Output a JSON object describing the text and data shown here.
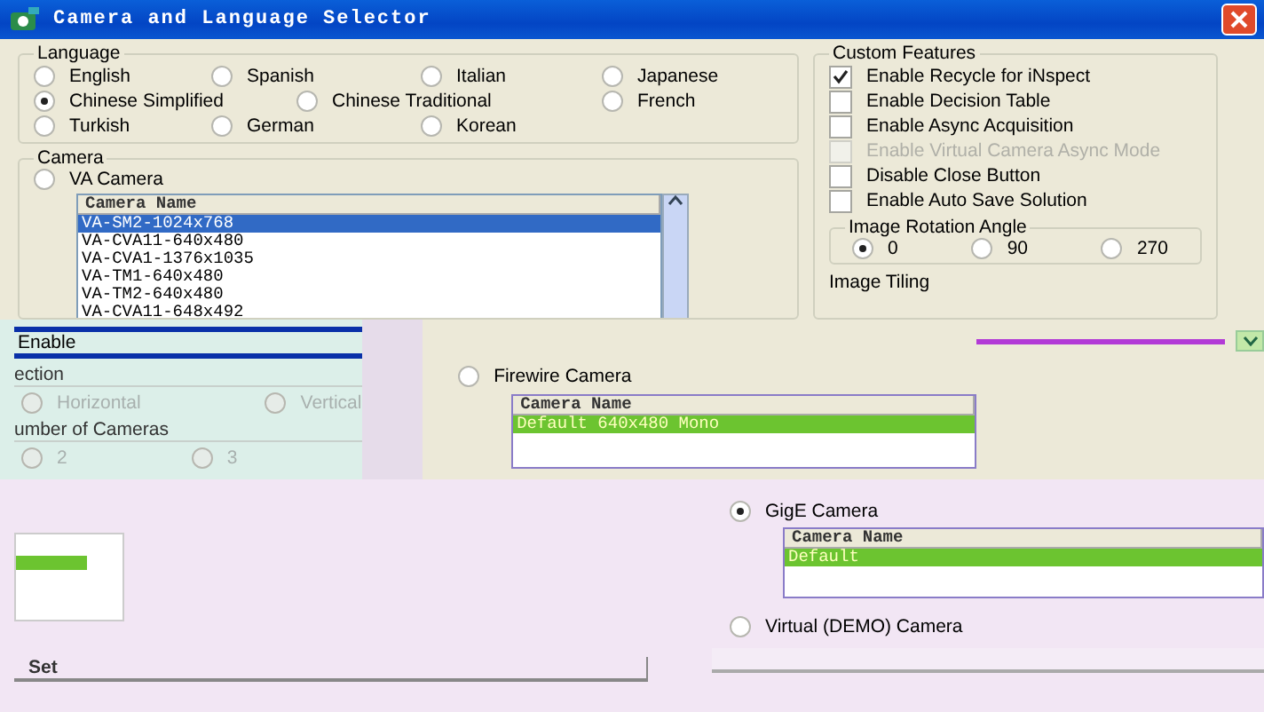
{
  "window": {
    "title": "Camera and Language Selector"
  },
  "language": {
    "title": "Language",
    "options": [
      {
        "label": "English",
        "selected": false
      },
      {
        "label": "Spanish",
        "selected": false
      },
      {
        "label": "Italian",
        "selected": false
      },
      {
        "label": "Japanese",
        "selected": false
      },
      {
        "label": "Chinese Simplified",
        "selected": true
      },
      {
        "label": "Chinese Traditional",
        "selected": false
      },
      {
        "label": "French",
        "selected": false
      },
      {
        "label": "Turkish",
        "selected": false
      },
      {
        "label": "German",
        "selected": false
      },
      {
        "label": "Korean",
        "selected": false
      }
    ]
  },
  "camera": {
    "title": "Camera",
    "va": {
      "label": "VA Camera",
      "selected": false,
      "column": "Camera Name",
      "rows": [
        {
          "text": "VA-SM2-1024x768",
          "selected": true
        },
        {
          "text": "VA-CVA11-640x480",
          "selected": false
        },
        {
          "text": "VA-CVA1-1376x1035",
          "selected": false
        },
        {
          "text": "VA-TM1-640x480",
          "selected": false
        },
        {
          "text": "VA-TM2-640x480",
          "selected": false
        },
        {
          "text": "VA-CVA11-648x492",
          "selected": false
        }
      ]
    },
    "firewire": {
      "label": "Firewire Camera",
      "selected": false,
      "column": "Camera Name",
      "rows": [
        {
          "text": "Default 640x480 Mono",
          "selected": true
        }
      ]
    },
    "gige": {
      "label": "GigE Camera",
      "selected": true,
      "column": "Camera Name",
      "rows": [
        {
          "text": "Default",
          "selected": true
        }
      ]
    },
    "virtual": {
      "label": "Virtual (DEMO) Camera",
      "selected": false
    }
  },
  "custom_features": {
    "title": "Custom Features",
    "options": [
      {
        "label": "Enable Recycle for iNspect",
        "checked": true,
        "disabled": false
      },
      {
        "label": "Enable Decision Table",
        "checked": false,
        "disabled": false
      },
      {
        "label": "Enable Async Acquisition",
        "checked": false,
        "disabled": false
      },
      {
        "label": "Enable Virtual Camera Async Mode",
        "checked": false,
        "disabled": true
      },
      {
        "label": "Disable Close Button",
        "checked": false,
        "disabled": false
      },
      {
        "label": "Enable Auto Save Solution",
        "checked": false,
        "disabled": false
      }
    ],
    "rotation": {
      "title": "Image Rotation Angle",
      "options": [
        {
          "label": "0",
          "selected": true
        },
        {
          "label": "90",
          "selected": false
        },
        {
          "label": "270",
          "selected": false
        }
      ]
    },
    "tiling": {
      "title": "Image Tiling"
    }
  },
  "tiling_fragment": {
    "enable": "Enable",
    "direction": {
      "title": "ection",
      "options": [
        {
          "label": "Horizontal",
          "selected": false,
          "disabled": true
        },
        {
          "label": "Vertical",
          "selected": false,
          "disabled": true
        }
      ]
    },
    "count": {
      "title": "umber of Cameras",
      "options": [
        {
          "label": "2",
          "selected": false,
          "disabled": true
        },
        {
          "label": "3",
          "selected": false,
          "disabled": true
        }
      ]
    }
  },
  "set_button": "Set"
}
